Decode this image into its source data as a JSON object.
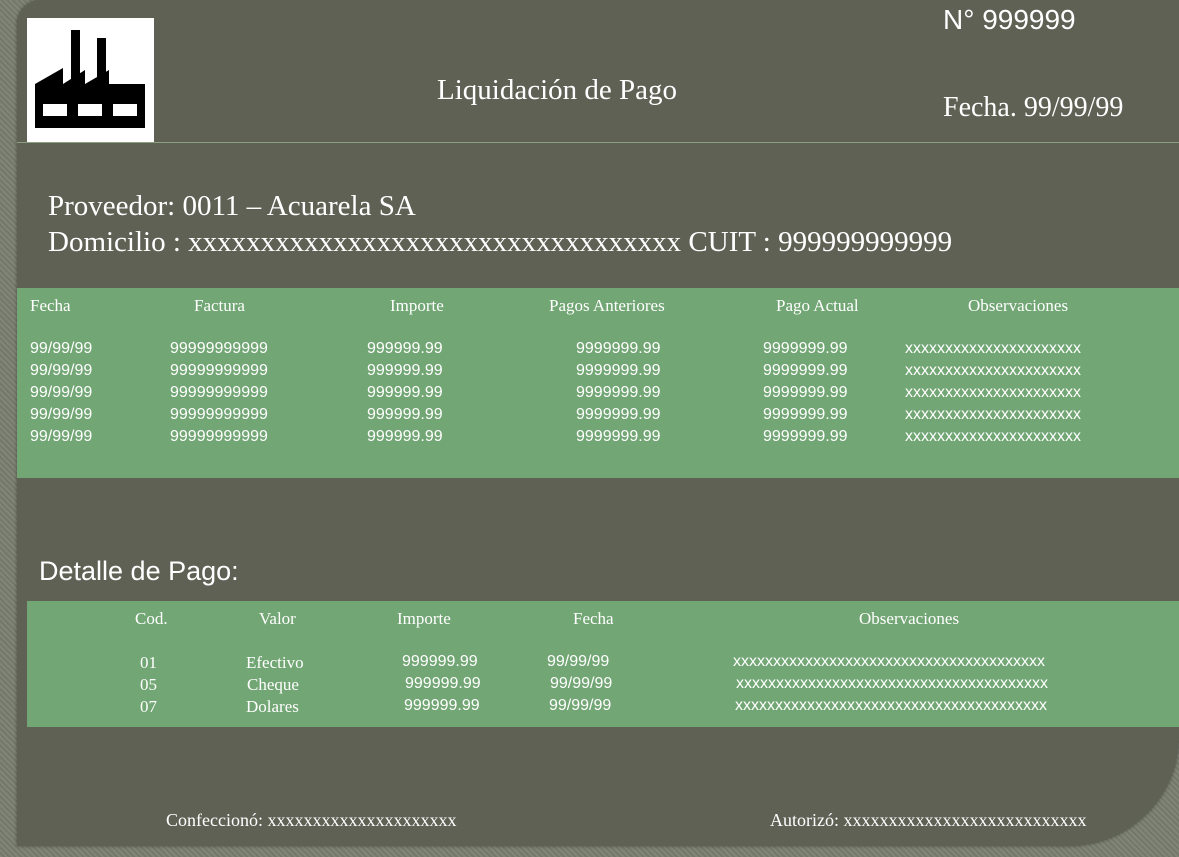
{
  "header": {
    "number": "N° 999999",
    "title": "Liquidación de Pago",
    "date": "Fecha. 99/99/99",
    "logo_icon": "factory-icon"
  },
  "supplier": {
    "provider_line": "Proveedor: 0011 – Acuarela SA",
    "address_line": "Domicilio : xxxxxxxxxxxxxxxxxxxxxxxxxxxxxxxxxx  CUIT : 999999999999"
  },
  "invoices": {
    "columns": [
      "Fecha",
      "Factura",
      "Importe",
      "Pagos Anteriores",
      "Pago Actual",
      "Observaciones"
    ],
    "rows": [
      [
        "99/99/99",
        "99999999999",
        "999999.99",
        "9999999.99",
        "9999999.99",
        "xxxxxxxxxxxxxxxxxxxxxx"
      ],
      [
        "99/99/99",
        "99999999999",
        "999999.99",
        "9999999.99",
        "9999999.99",
        "xxxxxxxxxxxxxxxxxxxxxx"
      ],
      [
        "99/99/99",
        "99999999999",
        "999999.99",
        "9999999.99",
        "9999999.99",
        "xxxxxxxxxxxxxxxxxxxxxx"
      ],
      [
        "99/99/99",
        "99999999999",
        "999999.99",
        "9999999.99",
        "9999999.99",
        "xxxxxxxxxxxxxxxxxxxxxx"
      ],
      [
        "99/99/99",
        "99999999999",
        "999999.99",
        "9999999.99",
        "9999999.99",
        "xxxxxxxxxxxxxxxxxxxxxx"
      ]
    ]
  },
  "payment_detail": {
    "title": "Detalle de Pago:",
    "columns": [
      "Cod.",
      "Valor",
      "Importe",
      "Fecha",
      "Observaciones"
    ],
    "rows": [
      [
        "01",
        "Efectivo",
        "999999.99",
        "99/99/99",
        "xxxxxxxxxxxxxxxxxxxxxxxxxxxxxxxxxxxxxxx"
      ],
      [
        "05",
        "Cheque",
        "999999.99",
        "99/99/99",
        "xxxxxxxxxxxxxxxxxxxxxxxxxxxxxxxxxxxxxxx"
      ],
      [
        "07",
        "Dolares",
        "999999.99",
        "99/99/99",
        "xxxxxxxxxxxxxxxxxxxxxxxxxxxxxxxxxxxxxxx"
      ]
    ]
  },
  "signatures": {
    "prepared": "Confeccionó: xxxxxxxxxxxxxxxxxxxxx",
    "authorized": "Autorizó: xxxxxxxxxxxxxxxxxxxxxxxxxxx"
  },
  "colors": {
    "panel": "#5f6155",
    "band": "#72a674",
    "background": "#7a7e70"
  }
}
